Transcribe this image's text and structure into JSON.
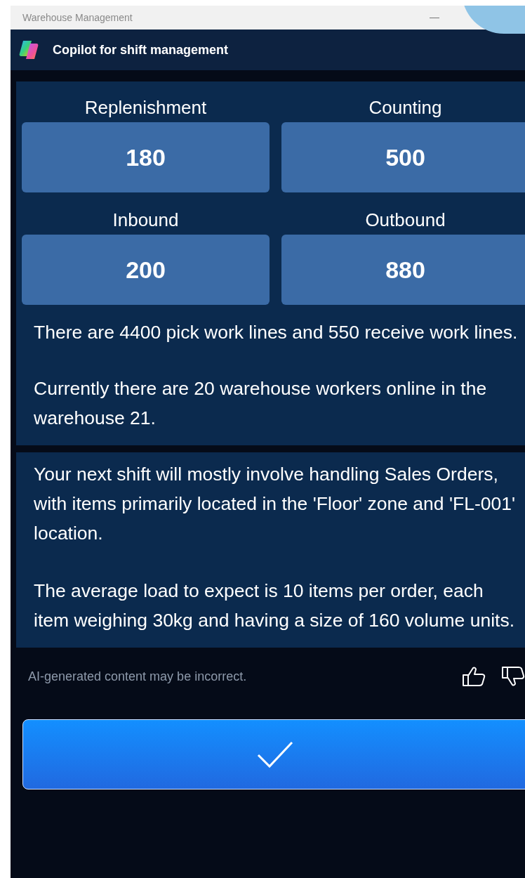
{
  "window": {
    "title": "Warehouse Management"
  },
  "header": {
    "title": "Copilot for shift management"
  },
  "stats": [
    {
      "label": "Replenishment",
      "value": "180"
    },
    {
      "label": "Counting",
      "value": "500"
    },
    {
      "label": "Inbound",
      "value": "200"
    },
    {
      "label": "Outbound",
      "value": "880"
    }
  ],
  "summary": [
    "There are 4400 pick work lines and 550 receive work lines.",
    "Currently there are 20 warehouse workers online in the warehouse 21."
  ],
  "forecast": [
    "Your next shift will mostly involve handling Sales Orders, with items primarily located in the 'Floor' zone and 'FL-001' location.",
    "The average load to expect is 10 items per order, each item weighing 30kg and having a size of 160 volume units."
  ],
  "disclaimer": "AI-generated content may be incorrect."
}
